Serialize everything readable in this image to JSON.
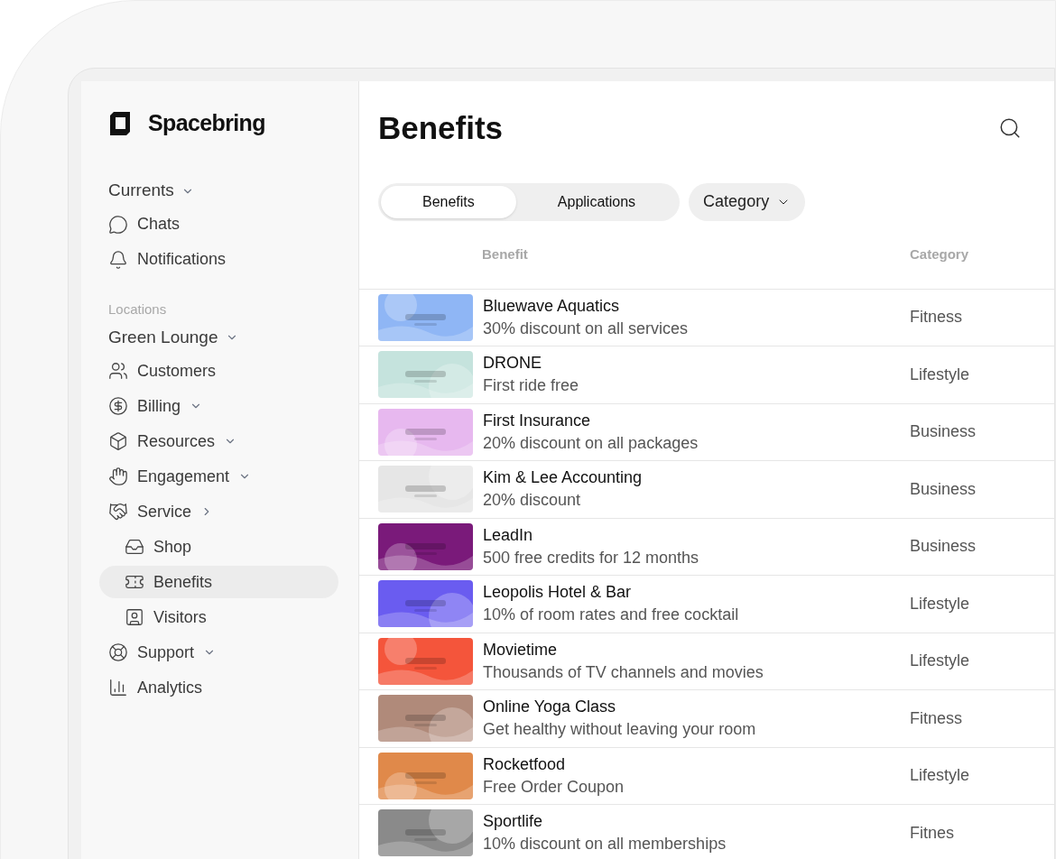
{
  "sidebar": {
    "brand": "Spacebring",
    "sections": [
      {
        "title": "Currents",
        "expanded": true,
        "items": [
          {
            "label": "Chats",
            "selected": false
          },
          {
            "label": "Notifications",
            "selected": false
          }
        ]
      },
      {
        "caption": "Locations",
        "title": "Green Lounge",
        "expanded": true,
        "items": [
          {
            "label": "Customers",
            "selected": false
          },
          {
            "label": "Billing",
            "expanded": true,
            "selected": false
          },
          {
            "label": "Resources",
            "expanded": true,
            "selected": false
          },
          {
            "label": "Engagement",
            "expanded": true,
            "selected": false
          },
          {
            "label": "Service",
            "expanded": false,
            "selected": false,
            "children": [
              {
                "label": "Shop",
                "selected": false
              },
              {
                "label": "Benefits",
                "selected": true
              },
              {
                "label": "Visitors",
                "selected": false
              }
            ]
          },
          {
            "label": "Support",
            "expanded": true,
            "selected": false
          },
          {
            "label": "Analytics",
            "selected": false
          }
        ]
      }
    ]
  },
  "main": {
    "title": "Benefits",
    "tabs": [
      {
        "label": "Benefits",
        "selected": true
      },
      {
        "label": "Applications",
        "selected": false
      }
    ],
    "filter": {
      "label": "Category"
    },
    "table": {
      "columns": [
        "Benefit",
        "Category"
      ],
      "rows": [
        {
          "name": "Bluewave Aquatics",
          "description": "30% discount on all services",
          "category": "Fitness",
          "color": "#8fb6f5"
        },
        {
          "name": "DRONE",
          "description": "First ride free",
          "category": "Lifestyle",
          "color": "#c5e3dd"
        },
        {
          "name": "First Insurance",
          "description": "20% discount on all packages",
          "category": "Business",
          "color": "#e7b8ef"
        },
        {
          "name": "Kim & Lee Accounting",
          "description": "20% discount",
          "category": "Business",
          "color": "#e6e6e6"
        },
        {
          "name": "LeadIn",
          "description": "500 free credits for 12 months",
          "category": "Business",
          "color": "#7a1a7a"
        },
        {
          "name": "Leopolis Hotel & Bar",
          "description": "10% of room rates and free cocktail",
          "category": "Lifestyle",
          "color": "#6a5cf0"
        },
        {
          "name": "Movietime",
          "description": "Thousands of TV channels and movies",
          "category": "Lifestyle",
          "color": "#f4553b"
        },
        {
          "name": "Online Yoga Class",
          "description": "Get healthy without leaving your room",
          "category": "Fitness",
          "color": "#b08a7a"
        },
        {
          "name": "Rocketfood",
          "description": "Free Order Coupon",
          "category": "Lifestyle",
          "color": "#e0894a"
        },
        {
          "name": "Sportlife",
          "description": "10% discount on all memberships",
          "category": "Fitnes",
          "color": "#8a8a8a"
        }
      ]
    }
  }
}
